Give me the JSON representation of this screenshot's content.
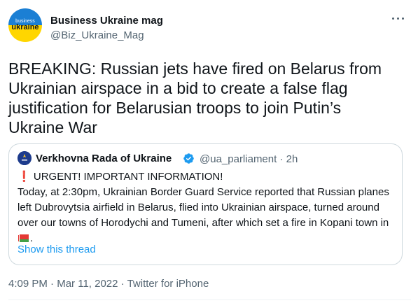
{
  "author": {
    "name": "Business Ukraine mag",
    "handle": "@Biz_Ukraine_Mag",
    "logo_text_top": "business",
    "logo_text_main": "ukraine"
  },
  "tweet": {
    "text": "BREAKING: Russian jets have fired on Belarus from Ukrainian airspace in a bid to create a false flag justification for Belarusian troops to join Putin’s Ukraine War"
  },
  "quote": {
    "name": "Verkhovna Rada of Ukraine",
    "handle": "@ua_parliament",
    "separator": "·",
    "time": "2h",
    "badge_color": "#1d9bf0",
    "alert_mark": "❗",
    "line1": "URGENT! IMPORTANT INFORMATION!",
    "body": "Today, at 2:30pm, Ukrainian Border Guard Service reported that Russian planes left Dubrovytsia airfield in Belarus, flied into Ukrainian airspace, turned around over our towns of Horodychi and Tumeni, after which set a fire in Kopani town in",
    "trailing": ".",
    "show_thread": "Show this thread"
  },
  "footer": {
    "time": "4:09 PM",
    "dot1": "·",
    "date": "Mar 11, 2022",
    "dot2": "·",
    "source": "Twitter for iPhone"
  },
  "colors": {
    "link": "#1d9bf0",
    "secondary_text": "#536471",
    "logo_blue": "#1b7fd4",
    "logo_yellow": "#ffd600"
  },
  "icons": [
    "business-ukraine-logo",
    "more-icon",
    "verified-badge-icon",
    "rada-logo",
    "exclamation-icon",
    "flag-icon"
  ]
}
